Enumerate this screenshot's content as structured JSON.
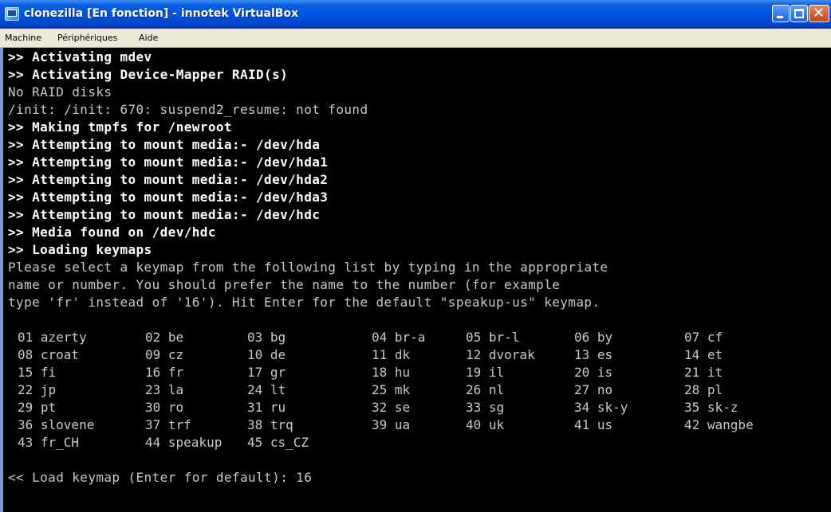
{
  "window": {
    "title": "clonezilla [En fonction] - innotek VirtualBox",
    "icon": "virtualbox-icon",
    "buttons": [
      "minimize-icon",
      "maximize-icon",
      "close-icon"
    ]
  },
  "menu": {
    "items": [
      "Machine",
      "Périphériques",
      "Aide"
    ]
  },
  "console": {
    "lines": [
      {
        "text": ">> Activating mdev",
        "bright": true
      },
      {
        "text": ">> Activating Device-Mapper RAID(s)",
        "bright": true
      },
      {
        "text": "No RAID disks",
        "bright": false
      },
      {
        "text": "/init: /init: 670: suspend2_resume: not found",
        "bright": false
      },
      {
        "text": ">> Making tmpfs for /newroot",
        "bright": true
      },
      {
        "text": ">> Attempting to mount media:- /dev/hda",
        "bright": true
      },
      {
        "text": ">> Attempting to mount media:- /dev/hda1",
        "bright": true
      },
      {
        "text": ">> Attempting to mount media:- /dev/hda2",
        "bright": true
      },
      {
        "text": ">> Attempting to mount media:- /dev/hda3",
        "bright": true
      },
      {
        "text": ">> Attempting to mount media:- /dev/hdc",
        "bright": true
      },
      {
        "text": ">> Media found on /dev/hdc",
        "bright": true
      },
      {
        "text": ">> Loading keymaps",
        "bright": true
      },
      {
        "text": "Please select a keymap from the following list by typing in the appropriate",
        "bright": false
      },
      {
        "text": "name or number. You should prefer the name to the number (for example",
        "bright": false
      },
      {
        "text": "type 'fr' instead of '16'). Hit Enter for the default \"speakup-us\" keymap.",
        "bright": false
      }
    ],
    "keymap_rows": [
      [
        "01 azerty",
        "02 be",
        "03 bg",
        "04 br-a",
        "05 br-l",
        "06 by",
        "07 cf"
      ],
      [
        "08 croat",
        "09 cz",
        "10 de",
        "11 dk",
        "12 dvorak",
        "13 es",
        "14 et"
      ],
      [
        "15 fi",
        "16 fr",
        "17 gr",
        "18 hu",
        "19 il",
        "20 is",
        "21 it"
      ],
      [
        "22 jp",
        "23 la",
        "24 lt",
        "25 mk",
        "26 nl",
        "27 no",
        "28 pl"
      ],
      [
        "29 pt",
        "30 ro",
        "31 ru",
        "32 se",
        "33 sg",
        "34 sk-y",
        "35 sk-z"
      ],
      [
        "36 slovene",
        "37 trf",
        "38 trq",
        "39 ua",
        "40 uk",
        "41 us",
        "42 wangbe"
      ],
      [
        "43 fr_CH",
        "44 speakup",
        "45 cs_CZ"
      ]
    ],
    "prompt": "<< Load keymap (Enter for default): 16"
  },
  "colors": {
    "titlebar": "#0054e3",
    "menubar": "#ece9d8",
    "console_bg": "#000000",
    "console_text": "#c8c8c8",
    "console_bright": "#ffffff"
  }
}
